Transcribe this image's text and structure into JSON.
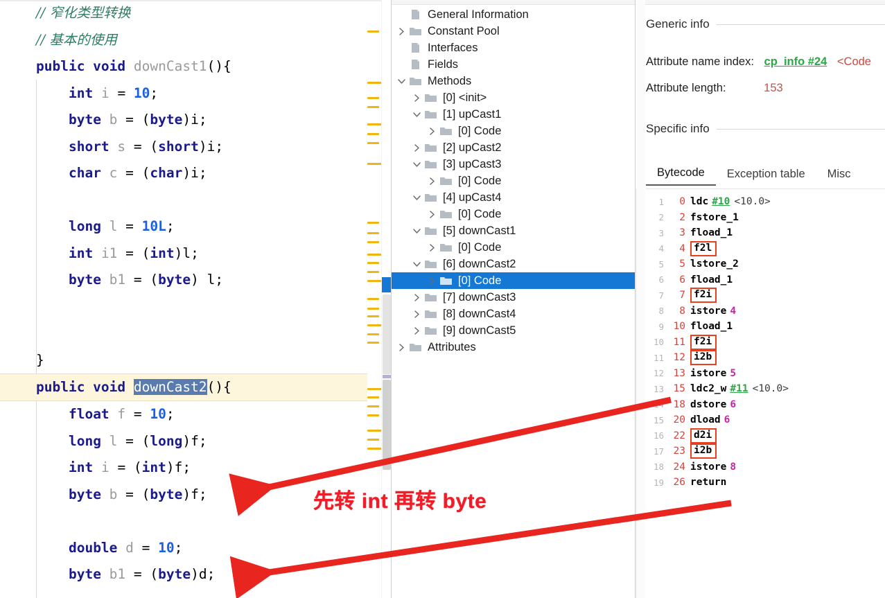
{
  "editor": {
    "lines": [
      {
        "indent": 0,
        "tokens": [
          {
            "t": "// 窄化类型转换",
            "c": "cmt"
          }
        ]
      },
      {
        "indent": 0,
        "tokens": [
          {
            "t": "// 基本的使用",
            "c": "cmt"
          }
        ]
      },
      {
        "indent": 0,
        "tokens": [
          {
            "t": "public void ",
            "c": "kw"
          },
          {
            "t": "downCast1",
            "c": "id"
          },
          {
            "t": "(){",
            "c": "pl"
          }
        ]
      },
      {
        "indent": 1,
        "tokens": [
          {
            "t": "int",
            "c": "kw"
          },
          {
            "t": " i ",
            "c": "id"
          },
          {
            "t": "= ",
            "c": "pl"
          },
          {
            "t": "10",
            "c": "num"
          },
          {
            "t": ";",
            "c": "pl"
          }
        ]
      },
      {
        "indent": 1,
        "tokens": [
          {
            "t": "byte",
            "c": "kw"
          },
          {
            "t": " b ",
            "c": "id"
          },
          {
            "t": "= (",
            "c": "pl"
          },
          {
            "t": "byte",
            "c": "kw"
          },
          {
            "t": ")i;",
            "c": "pl"
          }
        ]
      },
      {
        "indent": 1,
        "tokens": [
          {
            "t": "short",
            "c": "kw"
          },
          {
            "t": " s ",
            "c": "id"
          },
          {
            "t": "= (",
            "c": "pl"
          },
          {
            "t": "short",
            "c": "kw"
          },
          {
            "t": ")i;",
            "c": "pl"
          }
        ]
      },
      {
        "indent": 1,
        "tokens": [
          {
            "t": "char",
            "c": "kw"
          },
          {
            "t": " c ",
            "c": "id"
          },
          {
            "t": "= (",
            "c": "pl"
          },
          {
            "t": "char",
            "c": "kw"
          },
          {
            "t": ")i;",
            "c": "pl"
          }
        ]
      },
      {
        "indent": 0,
        "tokens": []
      },
      {
        "indent": 1,
        "tokens": [
          {
            "t": "long",
            "c": "kw"
          },
          {
            "t": " l ",
            "c": "id"
          },
          {
            "t": "= ",
            "c": "pl"
          },
          {
            "t": "10L",
            "c": "num"
          },
          {
            "t": ";",
            "c": "pl"
          }
        ]
      },
      {
        "indent": 1,
        "tokens": [
          {
            "t": "int",
            "c": "kw"
          },
          {
            "t": " i1 ",
            "c": "id"
          },
          {
            "t": "= (",
            "c": "pl"
          },
          {
            "t": "int",
            "c": "kw"
          },
          {
            "t": ")l;",
            "c": "pl"
          }
        ]
      },
      {
        "indent": 1,
        "tokens": [
          {
            "t": "byte",
            "c": "kw"
          },
          {
            "t": " b1 ",
            "c": "id"
          },
          {
            "t": "= (",
            "c": "pl"
          },
          {
            "t": "byte",
            "c": "kw"
          },
          {
            "t": ") l;",
            "c": "pl"
          }
        ]
      },
      {
        "indent": 0,
        "tokens": []
      },
      {
        "indent": 0,
        "tokens": []
      },
      {
        "indent": 0,
        "tokens": [
          {
            "t": "}",
            "c": "pl"
          }
        ]
      }
    ],
    "highlighted_line": {
      "tokens": [
        {
          "t": "public void ",
          "c": "kw"
        },
        {
          "t": "downCast2",
          "c": "sel"
        },
        {
          "t": "(){",
          "c": "pl"
        }
      ]
    },
    "lines_after": [
      {
        "indent": 1,
        "tokens": [
          {
            "t": "float",
            "c": "kw"
          },
          {
            "t": " f ",
            "c": "id"
          },
          {
            "t": "= ",
            "c": "pl"
          },
          {
            "t": "10",
            "c": "num"
          },
          {
            "t": ";",
            "c": "pl"
          }
        ]
      },
      {
        "indent": 1,
        "tokens": [
          {
            "t": "long",
            "c": "kw"
          },
          {
            "t": " l ",
            "c": "id"
          },
          {
            "t": "= (",
            "c": "pl"
          },
          {
            "t": "long",
            "c": "kw"
          },
          {
            "t": ")f;",
            "c": "pl"
          }
        ]
      },
      {
        "indent": 1,
        "tokens": [
          {
            "t": "int",
            "c": "kw"
          },
          {
            "t": " i ",
            "c": "id"
          },
          {
            "t": "= (",
            "c": "pl"
          },
          {
            "t": "int",
            "c": "kw"
          },
          {
            "t": ")f;",
            "c": "pl"
          }
        ]
      },
      {
        "indent": 1,
        "tokens": [
          {
            "t": "byte",
            "c": "kw"
          },
          {
            "t": " b ",
            "c": "id"
          },
          {
            "t": "= (",
            "c": "pl"
          },
          {
            "t": "byte",
            "c": "kw"
          },
          {
            "t": ")f;",
            "c": "pl"
          }
        ]
      },
      {
        "indent": 0,
        "tokens": []
      },
      {
        "indent": 1,
        "tokens": [
          {
            "t": "double",
            "c": "kw"
          },
          {
            "t": " d ",
            "c": "id"
          },
          {
            "t": "= ",
            "c": "pl"
          },
          {
            "t": "10",
            "c": "num"
          },
          {
            "t": ";",
            "c": "pl"
          }
        ]
      },
      {
        "indent": 1,
        "tokens": [
          {
            "t": "byte",
            "c": "kw"
          },
          {
            "t": " b1 ",
            "c": "id"
          },
          {
            "t": "= (",
            "c": "pl"
          },
          {
            "t": "byte",
            "c": "kw"
          },
          {
            "t": ")d;",
            "c": "pl"
          }
        ]
      }
    ],
    "selected_text": "downCast2"
  },
  "tree": {
    "items": [
      {
        "label": "General Information",
        "indent": 1,
        "twisty": "none",
        "icon": "file-icon",
        "selected": false
      },
      {
        "label": "Constant Pool",
        "indent": 1,
        "twisty": "collapsed",
        "icon": "folder-icon",
        "selected": false
      },
      {
        "label": "Interfaces",
        "indent": 1,
        "twisty": "none",
        "icon": "file-icon",
        "selected": false
      },
      {
        "label": "Fields",
        "indent": 1,
        "twisty": "none",
        "icon": "file-icon",
        "selected": false
      },
      {
        "label": "Methods",
        "indent": 1,
        "twisty": "expanded",
        "icon": "folder-icon",
        "selected": false
      },
      {
        "label": "[0] <init>",
        "indent": 2,
        "twisty": "collapsed",
        "icon": "folder-icon",
        "selected": false
      },
      {
        "label": "[1] upCast1",
        "indent": 2,
        "twisty": "expanded",
        "icon": "folder-icon",
        "selected": false
      },
      {
        "label": "[0] Code",
        "indent": 3,
        "twisty": "collapsed",
        "icon": "folder-icon",
        "selected": false
      },
      {
        "label": "[2] upCast2",
        "indent": 2,
        "twisty": "collapsed",
        "icon": "folder-icon",
        "selected": false
      },
      {
        "label": "[3] upCast3",
        "indent": 2,
        "twisty": "expanded",
        "icon": "folder-icon",
        "selected": false
      },
      {
        "label": "[0] Code",
        "indent": 3,
        "twisty": "collapsed",
        "icon": "folder-icon",
        "selected": false
      },
      {
        "label": "[4] upCast4",
        "indent": 2,
        "twisty": "expanded",
        "icon": "folder-icon",
        "selected": false
      },
      {
        "label": "[0] Code",
        "indent": 3,
        "twisty": "collapsed",
        "icon": "folder-icon",
        "selected": false
      },
      {
        "label": "[5] downCast1",
        "indent": 2,
        "twisty": "expanded",
        "icon": "folder-icon",
        "selected": false
      },
      {
        "label": "[0] Code",
        "indent": 3,
        "twisty": "collapsed",
        "icon": "folder-icon",
        "selected": false
      },
      {
        "label": "[6] downCast2",
        "indent": 2,
        "twisty": "expanded",
        "icon": "folder-icon",
        "selected": false
      },
      {
        "label": "[0] Code",
        "indent": 3,
        "twisty": "collapsed",
        "icon": "folder-icon",
        "selected": true
      },
      {
        "label": "[7] downCast3",
        "indent": 2,
        "twisty": "collapsed",
        "icon": "folder-icon",
        "selected": false
      },
      {
        "label": "[8] downCast4",
        "indent": 2,
        "twisty": "collapsed",
        "icon": "folder-icon",
        "selected": false
      },
      {
        "label": "[9] downCast5",
        "indent": 2,
        "twisty": "collapsed",
        "icon": "folder-icon",
        "selected": false
      },
      {
        "label": "Attributes",
        "indent": 1,
        "twisty": "collapsed",
        "icon": "folder-icon",
        "selected": false
      }
    ]
  },
  "detail": {
    "generic_info_title": "Generic info",
    "specific_info_title": "Specific info",
    "attribute_name_index_label": "Attribute name index:",
    "attribute_name_index_link": "cp_info #24",
    "attribute_name_index_value": "<Code",
    "attribute_length_label": "Attribute length:",
    "attribute_length_value": "153",
    "tabs": [
      {
        "label": "Bytecode",
        "active": true
      },
      {
        "label": "Exception table",
        "active": false
      },
      {
        "label": "Misc",
        "active": false
      }
    ],
    "bytecode": [
      {
        "line": "1",
        "offset": "0",
        "op": "ldc",
        "boxed": false,
        "ref": "#10",
        "comment": "<10.0>",
        "arg": ""
      },
      {
        "line": "2",
        "offset": "2",
        "op": "fstore_1",
        "boxed": false,
        "ref": "",
        "comment": "",
        "arg": ""
      },
      {
        "line": "3",
        "offset": "3",
        "op": "fload_1",
        "boxed": false,
        "ref": "",
        "comment": "",
        "arg": ""
      },
      {
        "line": "4",
        "offset": "4",
        "op": "f2l",
        "boxed": true,
        "ref": "",
        "comment": "",
        "arg": ""
      },
      {
        "line": "5",
        "offset": "5",
        "op": "lstore_2",
        "boxed": false,
        "ref": "",
        "comment": "",
        "arg": ""
      },
      {
        "line": "6",
        "offset": "6",
        "op": "fload_1",
        "boxed": false,
        "ref": "",
        "comment": "",
        "arg": ""
      },
      {
        "line": "7",
        "offset": "7",
        "op": "f2i",
        "boxed": true,
        "ref": "",
        "comment": "",
        "arg": ""
      },
      {
        "line": "8",
        "offset": "8",
        "op": "istore",
        "boxed": false,
        "ref": "",
        "comment": "",
        "arg": "4"
      },
      {
        "line": "9",
        "offset": "10",
        "op": "fload_1",
        "boxed": false,
        "ref": "",
        "comment": "",
        "arg": ""
      },
      {
        "line": "10",
        "offset": "11",
        "op": "f2i",
        "boxed": true,
        "ref": "",
        "comment": "",
        "arg": ""
      },
      {
        "line": "11",
        "offset": "12",
        "op": "i2b",
        "boxed": true,
        "ref": "",
        "comment": "",
        "arg": ""
      },
      {
        "line": "12",
        "offset": "13",
        "op": "istore",
        "boxed": false,
        "ref": "",
        "comment": "",
        "arg": "5"
      },
      {
        "line": "13",
        "offset": "15",
        "op": "ldc2_w",
        "boxed": false,
        "ref": "#11",
        "comment": "<10.0>",
        "arg": ""
      },
      {
        "line": "14",
        "offset": "18",
        "op": "dstore",
        "boxed": false,
        "ref": "",
        "comment": "",
        "arg": "6"
      },
      {
        "line": "15",
        "offset": "20",
        "op": "dload",
        "boxed": false,
        "ref": "",
        "comment": "",
        "arg": "6"
      },
      {
        "line": "16",
        "offset": "22",
        "op": "d2i",
        "boxed": true,
        "ref": "",
        "comment": "",
        "arg": ""
      },
      {
        "line": "17",
        "offset": "23",
        "op": "i2b",
        "boxed": true,
        "ref": "",
        "comment": "",
        "arg": ""
      },
      {
        "line": "18",
        "offset": "24",
        "op": "istore",
        "boxed": false,
        "ref": "",
        "comment": "",
        "arg": "8"
      },
      {
        "line": "19",
        "offset": "26",
        "op": "return",
        "boxed": false,
        "ref": "",
        "comment": "",
        "arg": ""
      }
    ]
  },
  "annotations": {
    "note_text": "先转 int 再转 byte",
    "accent_color": "#f01c28",
    "box_color": "#e8401f",
    "selection_color": "#1478d4"
  }
}
